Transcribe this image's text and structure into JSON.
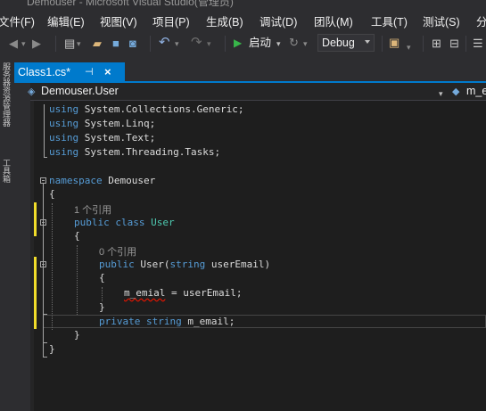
{
  "window": {
    "title": "Demouser - Microsoft Visual Studio(管理员)"
  },
  "menu": [
    {
      "label": "文件(F)"
    },
    {
      "label": "编辑(E)"
    },
    {
      "label": "视图(V)"
    },
    {
      "label": "项目(P)"
    },
    {
      "label": "生成(B)"
    },
    {
      "label": "调试(D)"
    },
    {
      "label": "团队(M)"
    },
    {
      "label": "工具(T)"
    },
    {
      "label": "测试(S)"
    },
    {
      "label": "分"
    }
  ],
  "toolbar": {
    "start_label": "启动",
    "configuration": "Debug"
  },
  "left_strip": {
    "item1": "服务器资源管理器",
    "item2": "工具箱"
  },
  "tab": {
    "label": "Class1.cs*",
    "pin": "⊣",
    "close": "×"
  },
  "navbar": {
    "type_label": "Demouser.User",
    "member_label": "m_e"
  },
  "code": {
    "l1": [
      "using",
      " System.Collections.Generic;"
    ],
    "l2": [
      "using",
      " System.Linq;"
    ],
    "l3": [
      "using",
      " System.Text;"
    ],
    "l4": [
      "using",
      " System.Threading.Tasks;"
    ],
    "l6": [
      "namespace",
      " Demouser"
    ],
    "l7": "{",
    "ref1": "1 个引用",
    "l8": [
      "public",
      " ",
      "class",
      " ",
      "User"
    ],
    "l9": "{",
    "ref2": "0 个引用",
    "l10": [
      "public",
      " User(",
      "string",
      " userEmail)"
    ],
    "l11": "{",
    "l12": [
      "m_emial",
      " = userEmail;"
    ],
    "l13": "}",
    "l14": [
      "private",
      " ",
      "string",
      " m_email;"
    ],
    "l15": "}",
    "l16": "}"
  },
  "colors": {
    "accent": "#007acc",
    "keyword": "#569cd6",
    "type": "#4ec9b0",
    "change_bar": "#efdb2a",
    "error_squiggle": "#e51400"
  }
}
